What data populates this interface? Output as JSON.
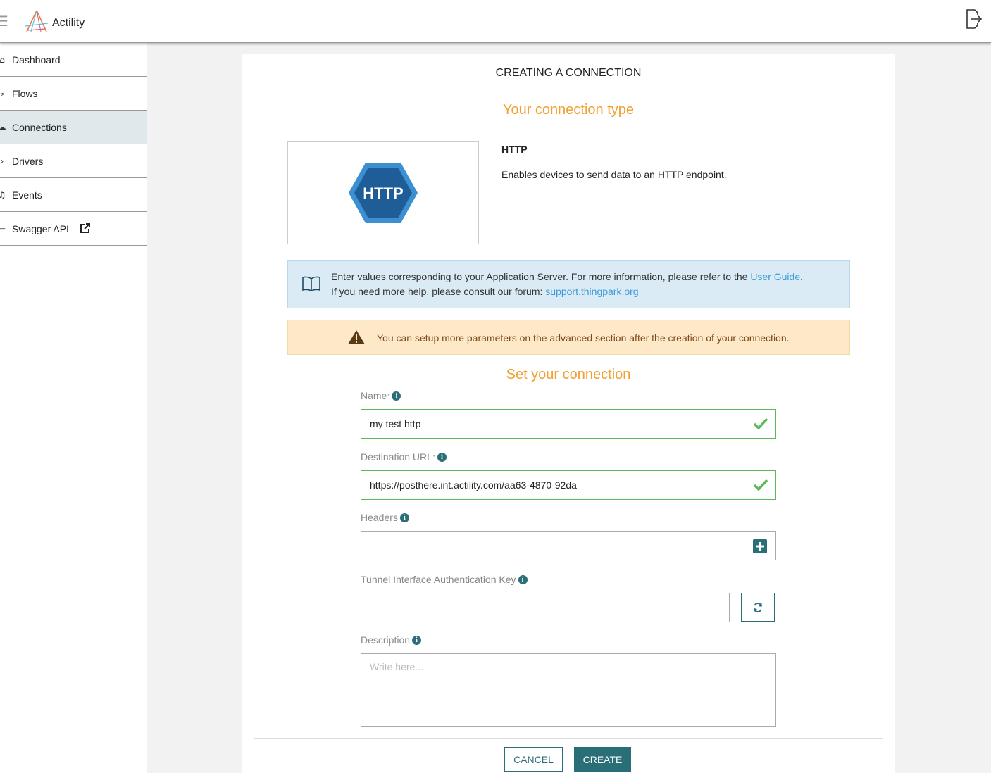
{
  "app": {
    "brand": "Actility"
  },
  "sidebar": {
    "items": [
      {
        "label": "Dashboard",
        "icon": "home-icon"
      },
      {
        "label": "Flows",
        "icon": "flow-icon"
      },
      {
        "label": "Connections",
        "icon": "cloud-icon",
        "active": true
      },
      {
        "label": "Drivers",
        "icon": "chevron-right-icon"
      },
      {
        "label": "Events",
        "icon": "bell-icon"
      },
      {
        "label": "Swagger API",
        "icon": "api-icon"
      }
    ]
  },
  "main": {
    "title": "CREATING A CONNECTION",
    "type_section_title": "Your connection type",
    "connection_type": {
      "logo_text": "HTTP",
      "name": "HTTP",
      "description": "Enables devices to send data to an HTTP endpoint."
    },
    "info": {
      "line1_text": "Enter values corresponding to your Application Server. For more information, please refer to the ",
      "line1_link": "User Guide",
      "line1_end": ".",
      "line2_text": "If you need more help, please consult our forum: ",
      "line2_link": "support.thingpark.org"
    },
    "warning": "You can setup more parameters on the advanced section after the creation of your connection.",
    "form_section_title": "Set your connection",
    "fields": {
      "name": {
        "label": "Name",
        "required_mark": "*",
        "value": "my test http"
      },
      "url": {
        "label": "Destination URL",
        "required_mark": "*",
        "value": "https://posthere.int.actility.com/aa63-4870-92da"
      },
      "headers": {
        "label": "Headers",
        "value": ""
      },
      "tunnel_key": {
        "label": "Tunnel Interface Authentication Key",
        "value": ""
      },
      "description": {
        "label": "Description",
        "placeholder": "Write here..."
      }
    },
    "info_dot": "i",
    "buttons": {
      "cancel": "CANCEL",
      "create": "CREATE"
    }
  },
  "colors": {
    "accent": "#2a6e78",
    "section_title": "#f0a030",
    "valid": "#5cb85c",
    "link": "#3a9bd5"
  }
}
